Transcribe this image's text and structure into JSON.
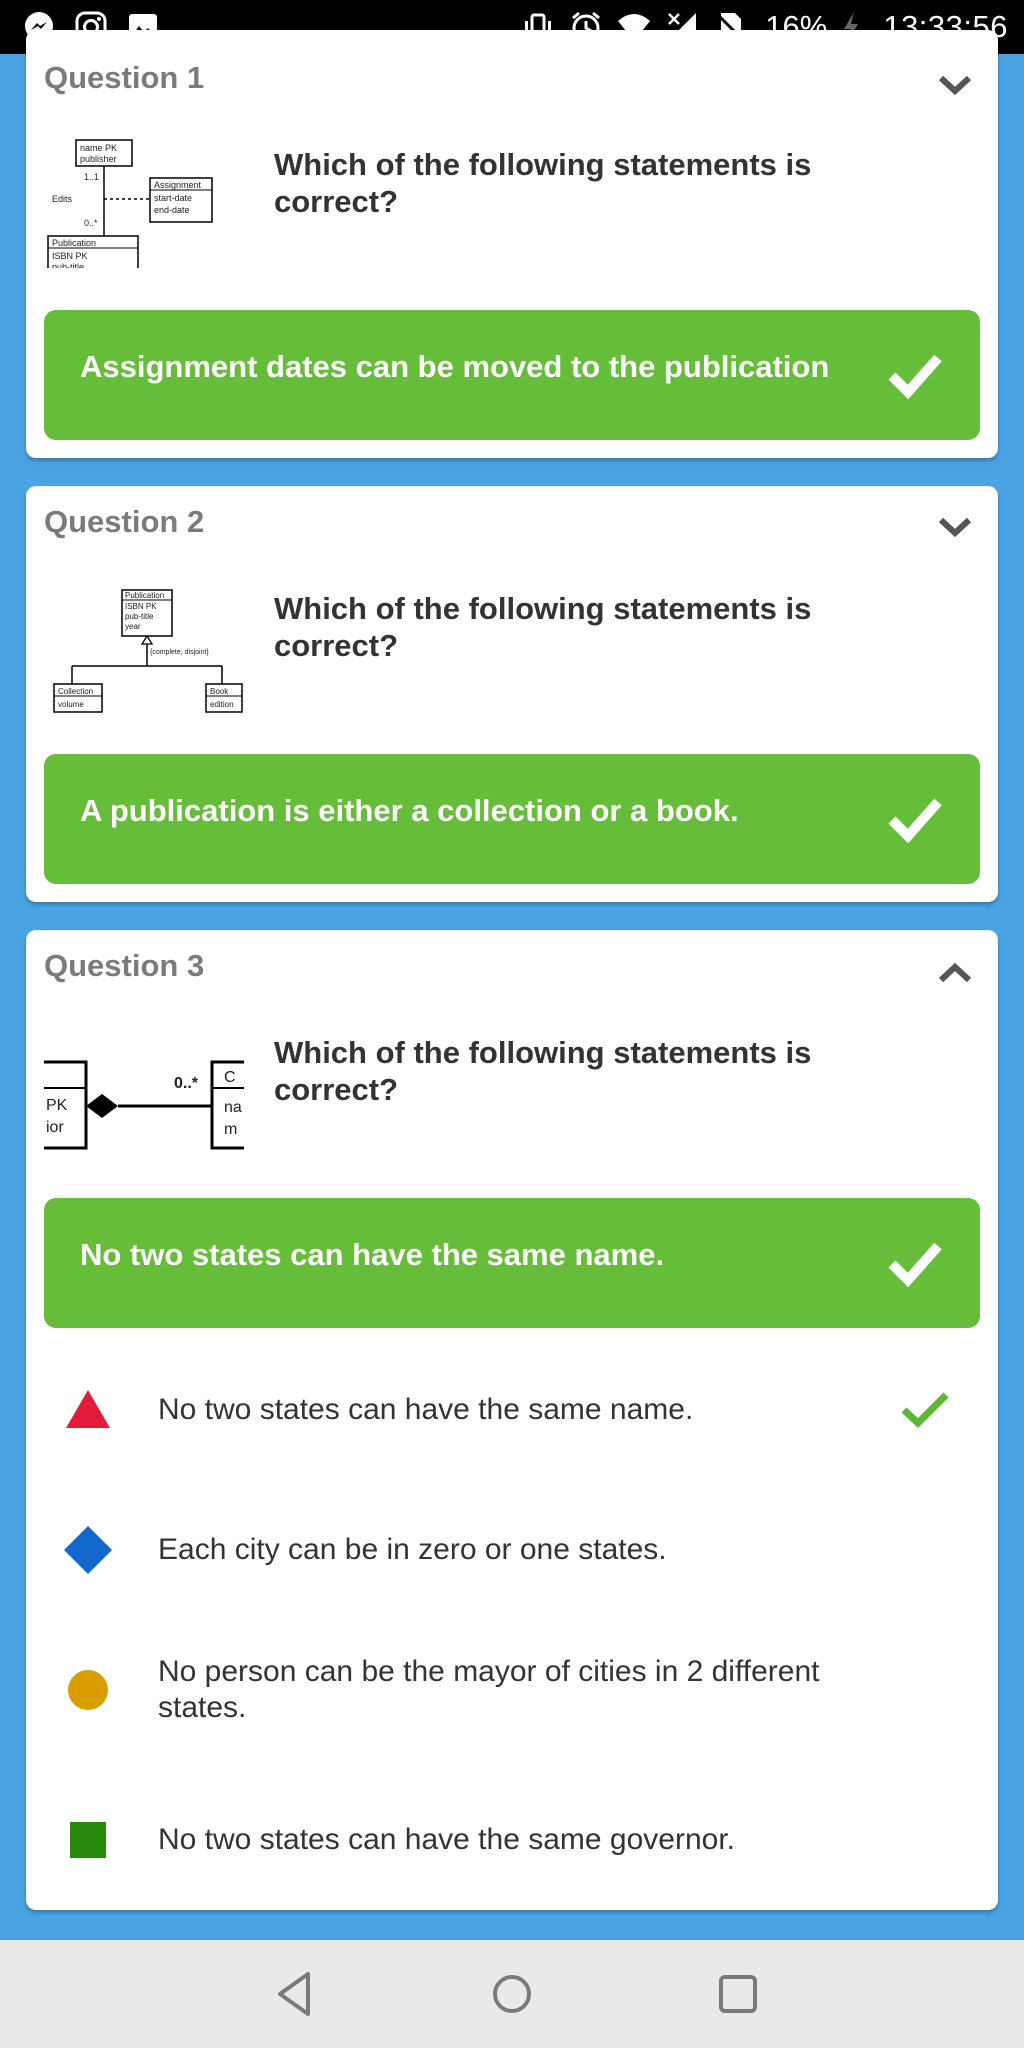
{
  "status_bar": {
    "battery_pct": "16%",
    "time": "13:33:56",
    "left_icons": [
      "messenger-icon",
      "instagram-icon",
      "gallery-icon"
    ],
    "right_icons": [
      "vibrate-icon",
      "alarm-icon",
      "wifi-icon",
      "mobile-signal-icon",
      "no-sim-icon",
      "charging-icon"
    ]
  },
  "questions": [
    {
      "title": "Question 1",
      "expanded": false,
      "prompt": "Which of the following statements is correct?",
      "diagram": {
        "boxes": [
          {
            "lines": [
              "name PK",
              "publisher"
            ]
          },
          {
            "lines": [
              "Assignment",
              "start-date",
              "end-date"
            ]
          },
          {
            "lines": [
              "Publication",
              "ISBN PK",
              "pub-title"
            ]
          }
        ],
        "labels": [
          "1..1",
          "Edits",
          "0..*"
        ]
      },
      "answer": "Assignment dates can be moved to the publication"
    },
    {
      "title": "Question 2",
      "expanded": false,
      "prompt": "Which of the following statements is correct?",
      "diagram": {
        "boxes": [
          {
            "lines": [
              "Publication",
              "ISBN PK",
              "pub-title",
              "year"
            ]
          },
          {
            "lines": [
              "Collection",
              "volume"
            ]
          },
          {
            "lines": [
              "Book",
              "edition"
            ]
          }
        ],
        "labels": [
          "{complete, disjoint}"
        ]
      },
      "answer": "A publication is either a collection or a book."
    },
    {
      "title": "Question 3",
      "expanded": true,
      "prompt": "Which of the following statements is correct?",
      "diagram": {
        "labels": [
          "PK",
          "ior",
          "0..*",
          "C",
          "na",
          "m"
        ]
      },
      "answer": "No two states can have the same name.",
      "options": [
        {
          "shape": "triangle",
          "color": "#e21b3c",
          "text": "No two states can have the same name.",
          "correct": true
        },
        {
          "shape": "diamond",
          "color": "#1368ce",
          "text": "Each city can be in zero or one states.",
          "correct": false
        },
        {
          "shape": "circle",
          "color": "#d89e00",
          "text": "No person can be the mayor of cities in 2 different states.",
          "correct": false
        },
        {
          "shape": "square",
          "color": "#26890c",
          "text": "No two states can have the same governor.",
          "correct": false
        }
      ]
    }
  ],
  "colors": {
    "background": "#4aa4e3",
    "answer_green": "#66bd3a",
    "check_green": "#5cb735"
  },
  "nav_bar": {
    "buttons": [
      "back-icon",
      "home-icon",
      "recents-icon"
    ]
  }
}
